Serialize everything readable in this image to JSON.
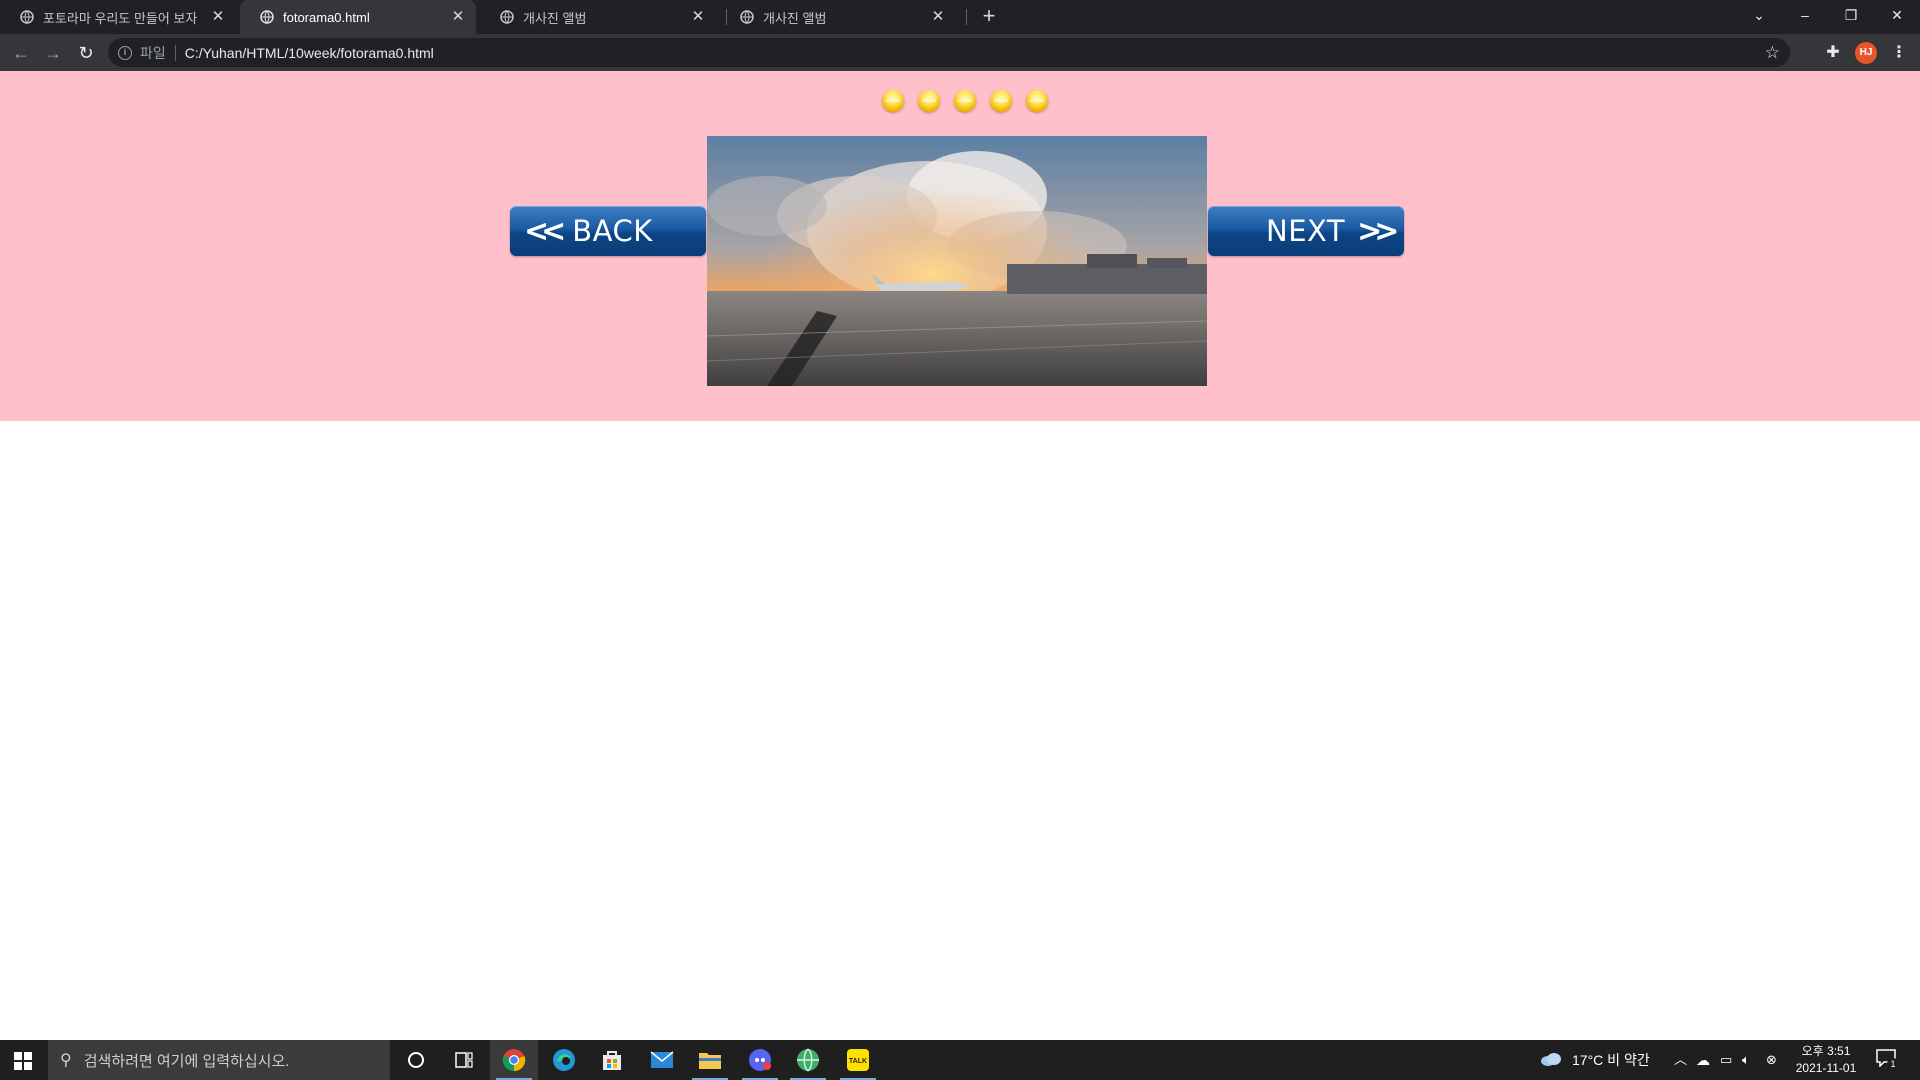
{
  "browser": {
    "tabs": [
      {
        "title": "포토라마 우리도 만들어 보자",
        "active": false
      },
      {
        "title": "fotorama0.html",
        "active": true
      },
      {
        "title": "개사진 앨범",
        "active": false
      },
      {
        "title": "개사진 앨범",
        "active": false
      }
    ],
    "omnibox": {
      "scheme_label": "파일",
      "url": "C:/Yuhan/HTML/10week/fotorama0.html"
    },
    "profile_initials": "HJ"
  },
  "page": {
    "background_band_color": "#ffc0cb",
    "indicator_dot_count": 5,
    "back_label": "BACK",
    "next_label": "NEXT",
    "photo_subject": "airport-runway-sunset-airplane"
  },
  "taskbar": {
    "search_placeholder": "검색하려면 여기에 입력하십시오.",
    "weather": "17°C  비 약간",
    "time": "오후 3:51",
    "date": "2021-11-01",
    "notification_count": "1"
  }
}
